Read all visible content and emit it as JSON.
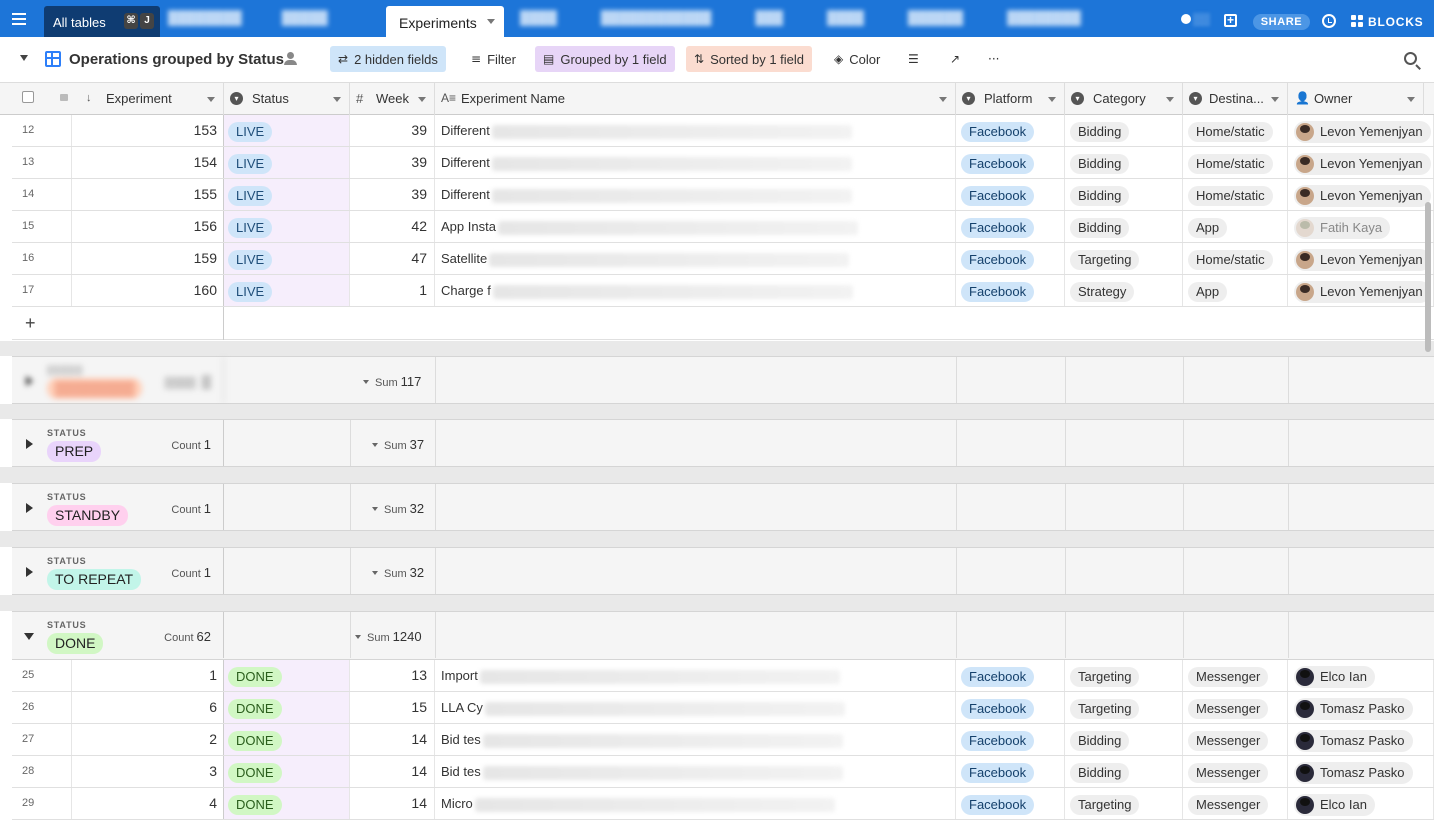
{
  "topbar": {
    "all_tables_label": "All tables",
    "shortcut_keys": [
      "⌘",
      "J"
    ],
    "active_tab": "Experiments",
    "share_label": "SHARE",
    "blocks_label": "BLOCKS"
  },
  "view": {
    "title": "Operations grouped by Status",
    "hidden_fields": "2 hidden fields",
    "filter": "Filter",
    "grouped": "Grouped by 1 field",
    "sorted": "Sorted by 1 field",
    "color": "Color"
  },
  "columns": {
    "experiment": "Experiment",
    "status": "Status",
    "week": "Week",
    "name": "Experiment Name",
    "platform": "Platform",
    "category": "Category",
    "destination": "Destina...",
    "owner": "Owner"
  },
  "live_rows": [
    {
      "num": "12",
      "exp": "153",
      "status": "LIVE",
      "week": "39",
      "name": "Different",
      "platform": "Facebook",
      "category": "Bidding",
      "dest": "Home/static",
      "owner": "Levon Yemenjyan",
      "edge": "V"
    },
    {
      "num": "13",
      "exp": "154",
      "status": "LIVE",
      "week": "39",
      "name": "Different",
      "platform": "Facebook",
      "category": "Bidding",
      "dest": "Home/static",
      "owner": "Levon Yemenjyan",
      "edge": "T"
    },
    {
      "num": "14",
      "exp": "155",
      "status": "LIVE",
      "week": "39",
      "name": "Different",
      "platform": "Facebook",
      "category": "Bidding",
      "dest": "Home/static",
      "owner": "Levon Yemenjyan",
      "edge": "V"
    },
    {
      "num": "15",
      "exp": "156",
      "status": "LIVE",
      "week": "42",
      "name": "App Insta",
      "platform": "Facebook",
      "category": "Bidding",
      "dest": "App",
      "owner": "Fatih Kaya",
      "edge": "V"
    },
    {
      "num": "16",
      "exp": "159",
      "status": "LIVE",
      "week": "47",
      "name": "Satellite",
      "platform": "Facebook",
      "category": "Targeting",
      "dest": "Home/static",
      "owner": "Levon Yemenjyan",
      "edge": "S"
    },
    {
      "num": "17",
      "exp": "160",
      "status": "LIVE",
      "week": "1",
      "name": "Charge f",
      "platform": "Facebook",
      "category": "Strategy",
      "dest": "App",
      "owner": "Levon Yemenjyan",
      "edge": "V"
    }
  ],
  "groups": {
    "status_label": "STATUS",
    "count_label": "Count",
    "sum_label": "Sum",
    "blurred_sum": "117",
    "prep": {
      "name": "PREP",
      "count": "1",
      "sum": "37"
    },
    "standby": {
      "name": "STANDBY",
      "count": "1",
      "sum": "32"
    },
    "to_repeat": {
      "name": "TO REPEAT",
      "count": "1",
      "sum": "32"
    },
    "done": {
      "name": "DONE",
      "count": "62",
      "sum": "1240"
    }
  },
  "done_rows": [
    {
      "num": "25",
      "exp": "1",
      "status": "DONE",
      "week": "13",
      "name": "Import",
      "platform": "Facebook",
      "category": "Targeting",
      "dest": "Messenger",
      "owner": "Elco Ian",
      "edge": "T"
    },
    {
      "num": "26",
      "exp": "6",
      "status": "DONE",
      "week": "15",
      "name": "LLA Cy",
      "platform": "Facebook",
      "category": "Targeting",
      "dest": "Messenger",
      "owner": "Tomasz Pasko",
      "edge": "V"
    },
    {
      "num": "27",
      "exp": "2",
      "status": "DONE",
      "week": "14",
      "name": "Bid tes",
      "platform": "Facebook",
      "category": "Bidding",
      "dest": "Messenger",
      "owner": "Tomasz Pasko",
      "edge": "B"
    },
    {
      "num": "28",
      "exp": "3",
      "status": "DONE",
      "week": "14",
      "name": "Bid tes",
      "platform": "Facebook",
      "category": "Bidding",
      "dest": "Messenger",
      "owner": "Tomasz Pasko",
      "edge": "B"
    },
    {
      "num": "29",
      "exp": "4",
      "status": "DONE",
      "week": "14",
      "name": "Micro",
      "platform": "Facebook",
      "category": "Targeting",
      "dest": "Messenger",
      "owner": "Elco Ian",
      "edge": "V"
    }
  ],
  "colors": {
    "topbar": "#1d75d8",
    "live_pill": "#cfe5f9",
    "done_pill": "#d1f7c4",
    "prep_pill": "#e9d4fb",
    "standby_pill": "#ffd0ee",
    "to_repeat_pill": "#c2f5e9"
  }
}
